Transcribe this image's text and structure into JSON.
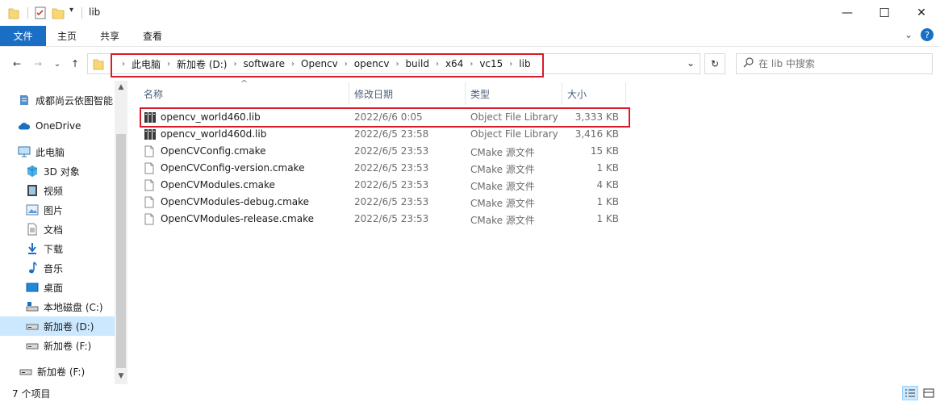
{
  "window": {
    "title": "lib",
    "minimize_glyph": "—",
    "maximize_glyph": "☐",
    "close_glyph": "✕",
    "qa_dropdown_glyph": "▾"
  },
  "ribbon": {
    "tabs": [
      "文件",
      "主页",
      "共享",
      "查看"
    ],
    "expand_glyph": "⌄",
    "help_glyph": "?"
  },
  "address": {
    "crumbs": [
      "此电脑",
      "新加卷 (D:)",
      "software",
      "Opencv",
      "opencv",
      "build",
      "x64",
      "vc15",
      "lib"
    ],
    "crumb_sep": "›",
    "dropdown_glyph": "⌄",
    "refresh_glyph": "↻"
  },
  "nav": {
    "back_glyph": "←",
    "forward_glyph": "→",
    "recent_glyph": "⌄",
    "up_glyph": "↑"
  },
  "search": {
    "placeholder": "在 lib 中搜索"
  },
  "sidebar": {
    "items": [
      {
        "label": "成都尚云依图智能",
        "icon": "pin-folder-icon"
      },
      {
        "label": "OneDrive",
        "icon": "onedrive-icon"
      },
      {
        "label": "此电脑",
        "icon": "computer-icon"
      },
      {
        "label": "3D 对象",
        "icon": "3d-objects-icon"
      },
      {
        "label": "视频",
        "icon": "video-icon"
      },
      {
        "label": "图片",
        "icon": "pictures-icon"
      },
      {
        "label": "文档",
        "icon": "documents-icon"
      },
      {
        "label": "下载",
        "icon": "download-icon"
      },
      {
        "label": "音乐",
        "icon": "music-icon"
      },
      {
        "label": "桌面",
        "icon": "desktop-icon"
      },
      {
        "label": "本地磁盘 (C:)",
        "icon": "drive-c-icon"
      },
      {
        "label": "新加卷 (D:)",
        "icon": "drive-icon"
      },
      {
        "label": "新加卷 (F:)",
        "icon": "drive-icon"
      },
      {
        "label": "新加卷 (F:)",
        "icon": "drive-icon"
      }
    ],
    "selected_index": 11,
    "scroll_up_glyph": "▲",
    "scroll_down_glyph": "▼"
  },
  "columns": {
    "name": "名称",
    "date": "修改日期",
    "type": "类型",
    "size": "大小",
    "sort_glyph": "^"
  },
  "files": [
    {
      "name": "opencv_world460.lib",
      "date": "2022/6/6 0:05",
      "type": "Object File Library",
      "size": "3,333 KB",
      "icon": "library-file-icon"
    },
    {
      "name": "opencv_world460d.lib",
      "date": "2022/6/5 23:58",
      "type": "Object File Library",
      "size": "3,416 KB",
      "icon": "library-file-icon"
    },
    {
      "name": "OpenCVConfig.cmake",
      "date": "2022/6/5 23:53",
      "type": "CMake 源文件",
      "size": "15 KB",
      "icon": "document-file-icon"
    },
    {
      "name": "OpenCVConfig-version.cmake",
      "date": "2022/6/5 23:53",
      "type": "CMake 源文件",
      "size": "1 KB",
      "icon": "document-file-icon"
    },
    {
      "name": "OpenCVModules.cmake",
      "date": "2022/6/5 23:53",
      "type": "CMake 源文件",
      "size": "4 KB",
      "icon": "document-file-icon"
    },
    {
      "name": "OpenCVModules-debug.cmake",
      "date": "2022/6/5 23:53",
      "type": "CMake 源文件",
      "size": "1 KB",
      "icon": "document-file-icon"
    },
    {
      "name": "OpenCVModules-release.cmake",
      "date": "2022/6/5 23:53",
      "type": "CMake 源文件",
      "size": "1 KB",
      "icon": "document-file-icon"
    }
  ],
  "status": {
    "item_count": "7 个项目"
  },
  "colors": {
    "accent": "#1a6fc4",
    "selection": "#cce8ff",
    "highlight_box": "#d81b2a",
    "folder": "#f8d775"
  }
}
